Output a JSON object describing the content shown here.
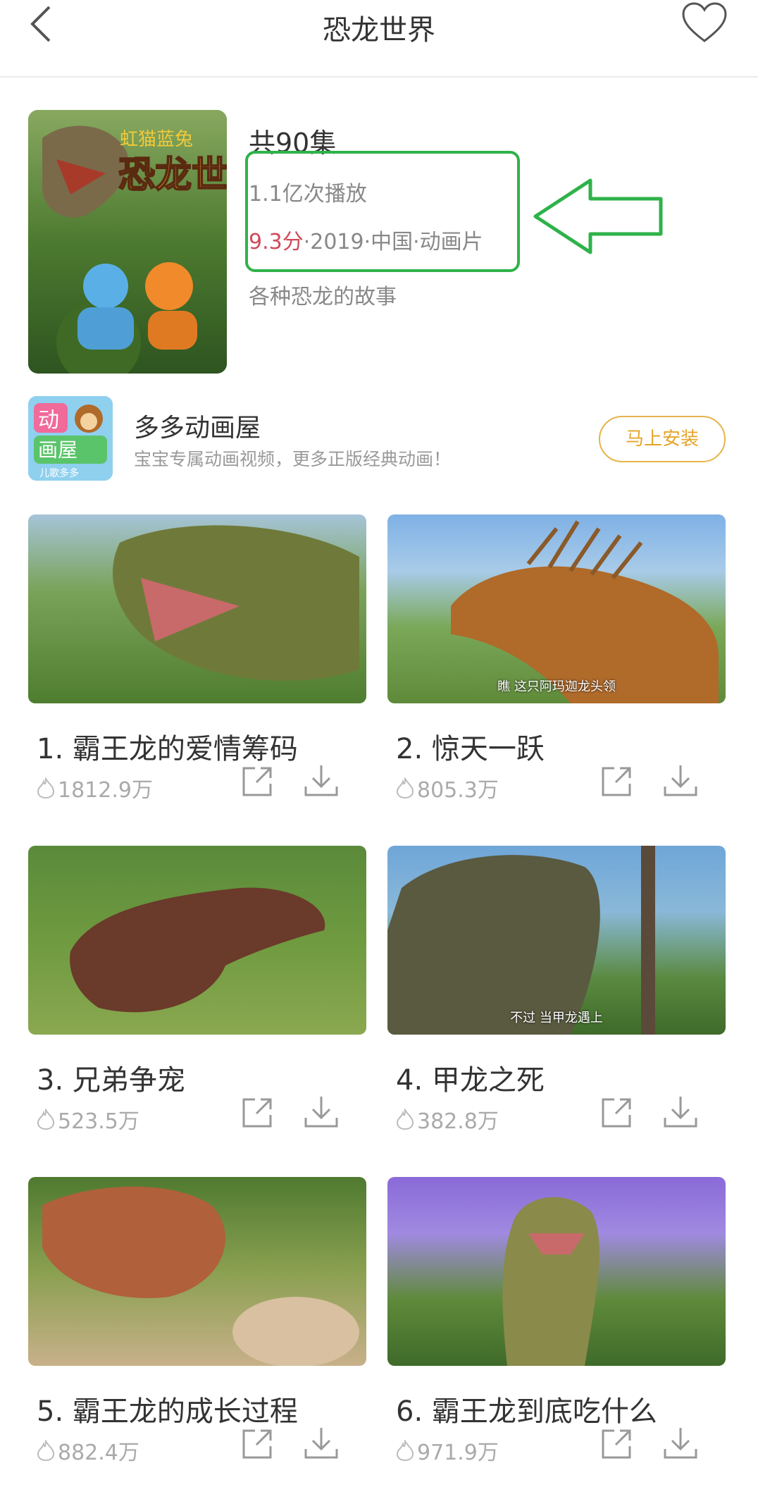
{
  "nav": {
    "title": "恐龙世界"
  },
  "show": {
    "poster_title": "恐龙世界",
    "poster_brand": "虹猫蓝兔",
    "episodes": "共90集",
    "plays": "1.1亿次播放",
    "score": "9.3分",
    "meta": "·2019·中国·动画片",
    "description": "各种恐龙的故事"
  },
  "promo": {
    "logo_line1": "动",
    "logo_line2": "画屋",
    "logo_caption": "儿歌多多",
    "app_name": "多多动画屋",
    "tagline": "宝宝专属动画视频，更多正版经典动画！",
    "install_label": "马上安装"
  },
  "episodes": [
    {
      "title": "1. 霸王龙的爱情筹码",
      "plays": "1812.9万",
      "subtitle": ""
    },
    {
      "title": "2. 惊天一跃",
      "plays": "805.3万",
      "subtitle": "瞧 这只阿玛迦龙头领"
    },
    {
      "title": "3. 兄弟争宠",
      "plays": "523.5万",
      "subtitle": ""
    },
    {
      "title": "4. 甲龙之死",
      "plays": "382.8万",
      "subtitle": "不过 当甲龙遇上"
    },
    {
      "title": "5. 霸王龙的成长过程",
      "plays": "882.4万",
      "subtitle": ""
    },
    {
      "title": "6. 霸王龙到底吃什么",
      "plays": "971.9万",
      "subtitle": ""
    }
  ],
  "colors": {
    "accent_green": "#2fb24a",
    "score_red": "#d04a5a",
    "install_gold": "#e6a42a"
  },
  "icons": {
    "back": "chevron-left-icon",
    "favorite": "heart-icon",
    "share": "share-icon",
    "download": "download-icon",
    "plays": "flame-icon"
  }
}
